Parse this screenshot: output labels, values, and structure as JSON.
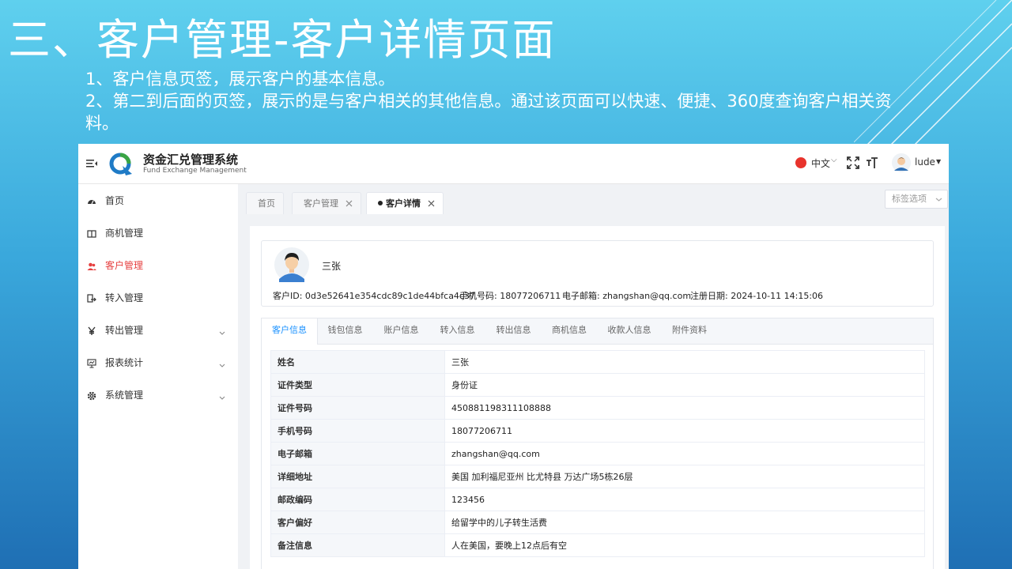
{
  "slide": {
    "title": "三、客户管理-客户详情页面",
    "bullets": [
      "1、客户信息页签，展示客户的基本信息。",
      "2、第二到后面的页签，展示的是与客户相关的其他信息。通过该页面可以快速、便捷、360度查询客户相关资料。"
    ]
  },
  "app": {
    "system_title": "资金汇兑管理系统",
    "system_subtitle": "Fund Exchange Management",
    "language": "中文",
    "username": "lude",
    "sidebar": [
      {
        "label": "首页",
        "icon": "dashboard-icon",
        "active": false,
        "submenu": false
      },
      {
        "label": "商机管理",
        "icon": "book-icon",
        "active": false,
        "submenu": false
      },
      {
        "label": "客户管理",
        "icon": "users-icon",
        "active": true,
        "submenu": false
      },
      {
        "label": "转入管理",
        "icon": "transfer-in-icon",
        "active": false,
        "submenu": false
      },
      {
        "label": "转出管理",
        "icon": "yen-icon",
        "active": false,
        "submenu": true
      },
      {
        "label": "报表统计",
        "icon": "monitor-chart-icon",
        "active": false,
        "submenu": true
      },
      {
        "label": "系统管理",
        "icon": "gear-icon",
        "active": false,
        "submenu": true
      }
    ],
    "tabs": [
      {
        "label": "首页",
        "closable": false,
        "active": false
      },
      {
        "label": "客户管理",
        "closable": true,
        "active": false
      },
      {
        "label": "客户详情",
        "closable": true,
        "active": true
      }
    ],
    "tab_options_label": "标签选项",
    "customer": {
      "name": "三张",
      "id_label": "客户ID:",
      "id_value": "0d3e52641e354cdc89c1de44bfca4c37",
      "phone_label": "手机号码:",
      "phone_value": "18077206711",
      "email_label": "电子邮箱:",
      "email_value": "zhangshan@qq.com",
      "reg_label": "注册日期:",
      "reg_value": "2024-10-11 14:15:06"
    },
    "detail_tabs": [
      "客户信息",
      "钱包信息",
      "账户信息",
      "转入信息",
      "转出信息",
      "商机信息",
      "收款人信息",
      "附件资料"
    ],
    "info_rows": [
      {
        "label": "姓名",
        "value": "三张"
      },
      {
        "label": "证件类型",
        "value": "身份证"
      },
      {
        "label": "证件号码",
        "value": "450881198311108888"
      },
      {
        "label": "手机号码",
        "value": "18077206711"
      },
      {
        "label": "电子邮箱",
        "value": "zhangshan@qq.com"
      },
      {
        "label": "详细地址",
        "value": "美国 加利福尼亚州 比尤特县 万达广场5栋26层"
      },
      {
        "label": "邮政编码",
        "value": "123456"
      },
      {
        "label": "客户偏好",
        "value": "给留学中的儿子转生活费"
      },
      {
        "label": "备注信息",
        "value": "人在美国，要晚上12点后有空"
      }
    ]
  }
}
